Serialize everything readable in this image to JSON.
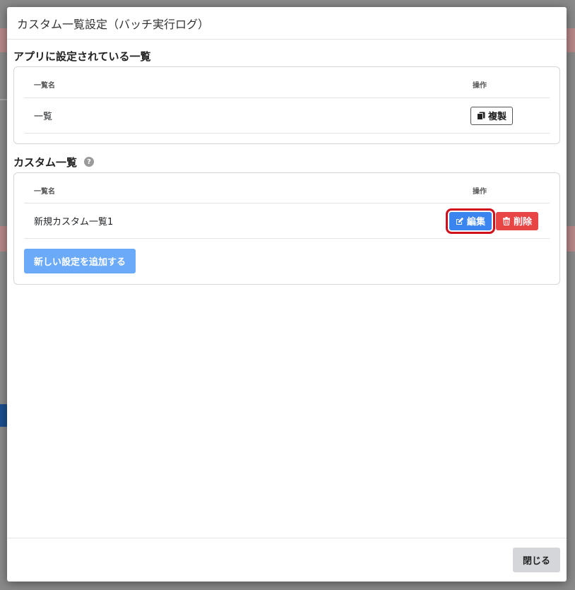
{
  "modal": {
    "title": "カスタム一覧設定（バッチ実行ログ）",
    "close_label": "閉じる"
  },
  "app_list": {
    "title": "アプリに設定されている一覧",
    "col_name": "一覧名",
    "col_ops": "操作",
    "rows": [
      {
        "name": "一覧",
        "copy_label": "複製"
      }
    ]
  },
  "custom_list": {
    "title": "カスタム一覧",
    "help_icon": "question-circle-icon",
    "col_name": "一覧名",
    "col_ops": "操作",
    "rows": [
      {
        "name": "新規カスタム一覧1",
        "edit_label": "編集",
        "delete_label": "削除"
      }
    ],
    "add_label": "新しい設定を追加する"
  },
  "colors": {
    "primary": "#3a85ef",
    "danger": "#e84545",
    "highlight": "#d0101b"
  }
}
